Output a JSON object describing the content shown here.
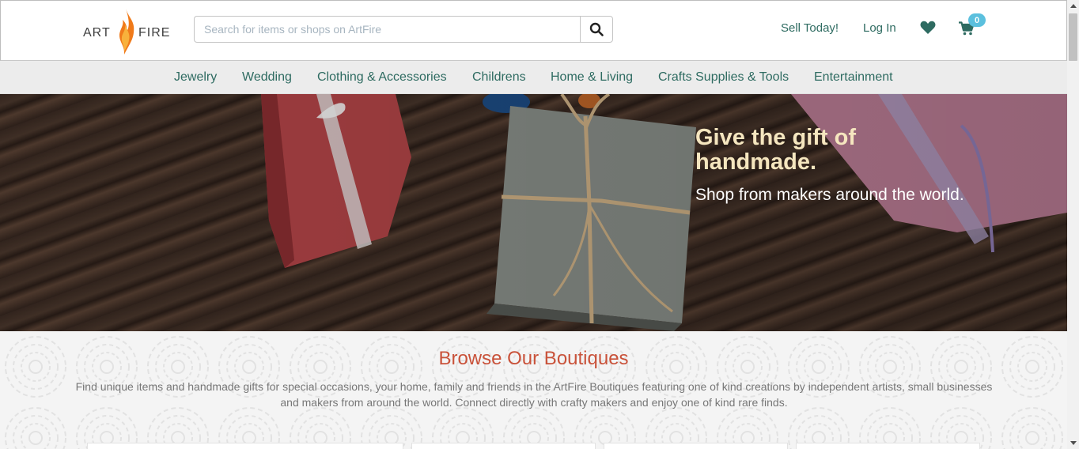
{
  "header": {
    "logo_left": "ART",
    "logo_right": "FIRE",
    "search_placeholder": "Search for items or shops on ArtFire",
    "search_icon": "search-icon",
    "sell_label": "Sell Today!",
    "login_label": "Log In",
    "favorites_icon": "heart-icon",
    "cart_icon": "cart-icon",
    "cart_count": "0",
    "colors": {
      "link": "#2e6b61",
      "badge": "#5bc0de",
      "logo_flame": "#f07a1a"
    }
  },
  "categories": [
    "Jewelry",
    "Wedding",
    "Clothing & Accessories",
    "Childrens",
    "Home & Living",
    "Crafts Supplies & Tools",
    "Entertainment"
  ],
  "hero": {
    "title_line1": "Give the gift of",
    "title_line2": "handmade.",
    "subtitle": "Shop from makers around the world."
  },
  "browse": {
    "title": "Browse Our Boutiques",
    "description": "Find unique items and handmade gifts for special occasions, your home, family and friends in the ArtFire Boutiques featuring one of kind creations by independent artists, small businesses and makers from around the world. Connect directly with crafty makers and enjoy one of kind rare finds.",
    "title_color": "#c9523a"
  }
}
